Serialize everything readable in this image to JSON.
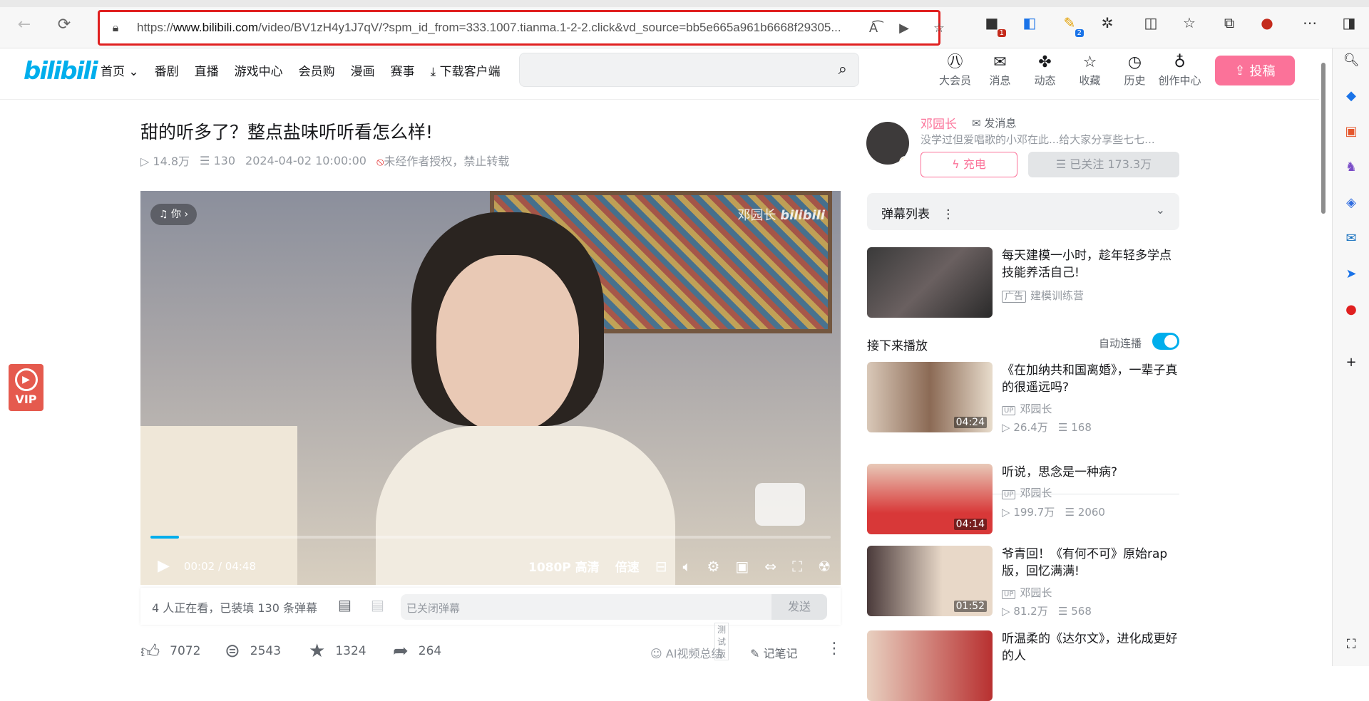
{
  "browser": {
    "url_prefix": "https://",
    "url_host": "www.bilibili.com",
    "url_rest": "/video/BV1zH4y1J7qV/?spm_id_from=333.1007.tianma.1-2-2.click&vd_source=bb5e665a961b6668f29305...",
    "ext_badge_1": "1",
    "ext_badge_2": "2"
  },
  "header": {
    "logo": "bilibili",
    "nav": [
      "首页",
      "番剧",
      "直播",
      "游戏中心",
      "会员购",
      "漫画",
      "赛事",
      "下载客户端"
    ],
    "icons": [
      {
        "label": "大会员",
        "icon": "vip-icon"
      },
      {
        "label": "消息",
        "icon": "mail-icon"
      },
      {
        "label": "动态",
        "icon": "pinwheel-icon"
      },
      {
        "label": "收藏",
        "icon": "star-icon"
      },
      {
        "label": "历史",
        "icon": "clock-icon"
      },
      {
        "label": "创作中心",
        "icon": "bulb-icon"
      }
    ],
    "upload": "投稿"
  },
  "vip_float": "VIP",
  "video": {
    "title": "甜的听多了？整点盐味听听看怎么样!",
    "views": "14.8万",
    "danmaku_count": "130",
    "date": "2024-04-02 10:00:00",
    "copyright": "未经作者授权，禁止转载",
    "music_pill": "你",
    "watermark": "邓园长",
    "progress": 0.007,
    "time_current": "00:02",
    "time_separator": "/",
    "time_total": "04:48",
    "quality": "1080P 高清",
    "speed": "倍速"
  },
  "danmaku_bar": {
    "watching": "4 人正在看，已装填 130 条弹幕",
    "placeholder": "已关闭弹幕",
    "send": "发送"
  },
  "actions": {
    "like": "7072",
    "coin": "2543",
    "fav": "1324",
    "share": "264",
    "ai_summary": "AI视频总结",
    "test_tag": "测试版",
    "notes": "记笔记"
  },
  "uploader": {
    "name": "邓园长",
    "message": "发消息",
    "desc": "没学过但爱唱歌的小邓在此...给大家分享些七七...",
    "charge": "充电",
    "follow": "已关注 173.3万"
  },
  "danmaku_list": "弹幕列表",
  "ad": {
    "title": "每天建模一小时，趁年轻多学点技能养活自己!",
    "tag": "广告",
    "source": "建模训练营"
  },
  "next_play": "接下来播放",
  "autoplay": "自动连播",
  "recommendations": [
    {
      "title": "《在加纳共和国离婚》，一辈子真的很遥远吗?",
      "up": "邓园长",
      "views": "26.4万",
      "danmaku": "168",
      "duration": "04:24"
    },
    {
      "title": "听说，思念是一种病?",
      "up": "邓园长",
      "views": "199.7万",
      "danmaku": "2060",
      "duration": "04:14"
    },
    {
      "title": "爷青回！《有何不可》原始rap版，回忆满满!",
      "up": "邓园长",
      "views": "81.2万",
      "danmaku": "568",
      "duration": "01:52"
    },
    {
      "title": "听温柔的《达尔文》，进化成更好的人"
    }
  ],
  "colors": {
    "accent": "#00aeec",
    "pink": "#fb7299",
    "red_box": "#e02020"
  }
}
